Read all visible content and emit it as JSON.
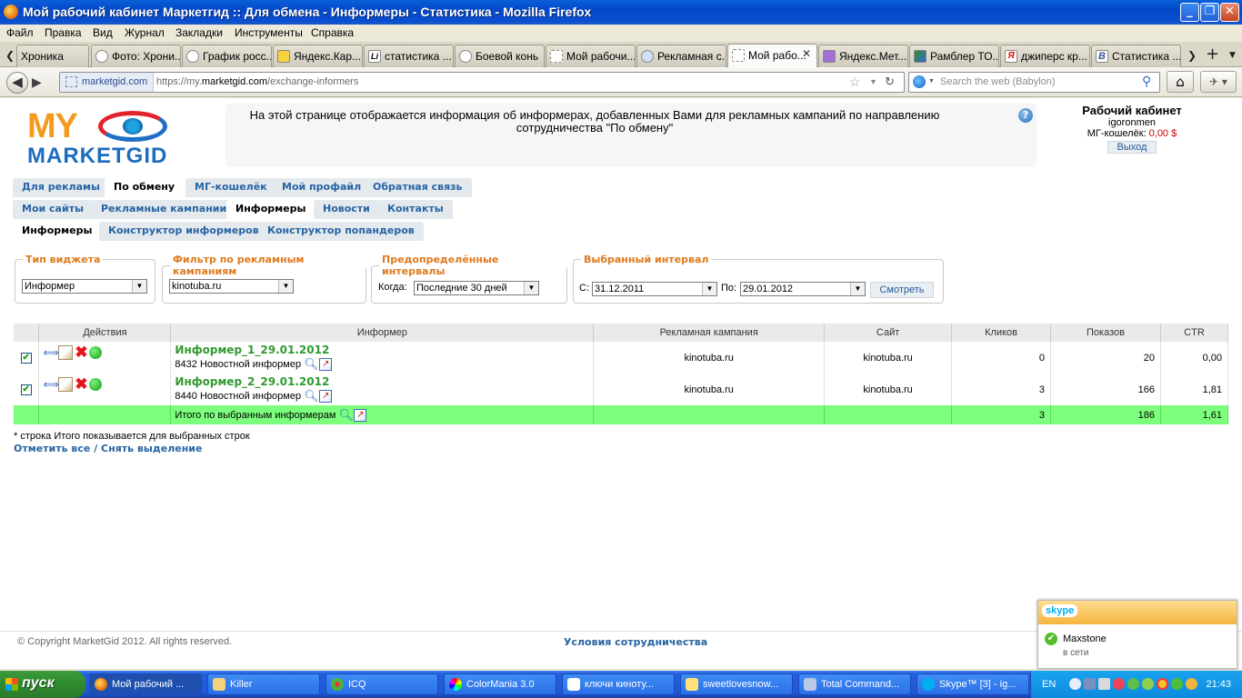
{
  "window": {
    "title": "Мой рабочий кабинет Маркетгид :: Для обмена - Информеры - Статистика - Mozilla Firefox",
    "min": "_",
    "max": "❐",
    "close": "✕"
  },
  "menu": [
    "Файл",
    "Правка",
    "Вид",
    "Журнал",
    "Закладки",
    "Инструменты",
    "Справка"
  ],
  "tabs": [
    "Хроника",
    "Фото: Хрони...",
    "График росс...",
    "Яндекс.Кар...",
    "статистика ...",
    "Боевой конь",
    "Мой рабочи...",
    "Рекламная с...",
    "Мой рабо...",
    "Яндекс.Мет...",
    "Рамблер ТО...",
    "джиперс кр...",
    "Статистика ..."
  ],
  "tab_icon_letters": {
    "statistika": "Li",
    "last": "B",
    "yandex": "Я"
  },
  "address": {
    "site": "marketgid.com",
    "url_prefix": "https://my.",
    "url_domain": "marketgid.com",
    "url_path": "/exchange-informers"
  },
  "search": {
    "placeholder": "Search the web (Babylon)"
  },
  "logo": {
    "my": "MY",
    "brand": "MARKETGID"
  },
  "info": "На этой странице отображается информация об информерах, добавленных Вами для рекламных кампаний по направлению сотрудничества \"По обмену\"",
  "help": "?",
  "account": {
    "title": "Рабочий кабинет",
    "user": "igoronmen",
    "wallet_label": "МГ-кошелёк:",
    "wallet_value": "0,00 $",
    "logout": "Выход"
  },
  "nav1": [
    "Для рекламы",
    "По обмену",
    "МГ-кошелёк",
    "Мой профайл",
    "Обратная связь"
  ],
  "nav2": [
    "Мои сайты",
    "Рекламные кампании",
    "Информеры",
    "Новости",
    "Контакты"
  ],
  "nav3": [
    "Информеры",
    "Конструктор информеров",
    "Конструктор попандеров"
  ],
  "filters": {
    "widget_type": {
      "legend": "Тип виджета",
      "value": "Информер"
    },
    "campaign": {
      "legend": "Фильтр по рекламным кампаниям",
      "value": "kinotuba.ru"
    },
    "preset": {
      "legend": "Предопределённые интервалы",
      "label": "Когда:",
      "value": "Последние 30 дней"
    },
    "interval": {
      "legend": "Выбранный интервал",
      "from_label": "С:",
      "from": "31.12.2011",
      "to_label": "По:",
      "to": "29.01.2012",
      "show": "Смотреть"
    }
  },
  "table": {
    "headers": [
      "",
      "Действия",
      "Информер",
      "Рекламная кампания",
      "Сайт",
      "Кликов",
      "Показов",
      "CTR"
    ],
    "rows": [
      {
        "name": "Информер_1_29.01.2012",
        "desc": "8432 Новостной информер",
        "campaign": "kinotuba.ru",
        "site": "kinotuba.ru",
        "clicks": "0",
        "shows": "20",
        "ctr": "0,00"
      },
      {
        "name": "Информер_2_29.01.2012",
        "desc": "8440 Новостной информер",
        "campaign": "kinotuba.ru",
        "site": "kinotuba.ru",
        "clicks": "3",
        "shows": "166",
        "ctr": "1,81"
      }
    ],
    "total": {
      "label": "Итого по выбранным информерам",
      "clicks": "3",
      "shows": "186",
      "ctr": "1,61"
    }
  },
  "note": "* строка Итого показывается для выбранных строк",
  "select_all": "Отметить все / Снять выделение",
  "footer": {
    "copyright": "© Copyright MarketGid 2012. All rights reserved.",
    "terms": "Условия сотрудничества"
  },
  "skype": {
    "logo": "skype",
    "contact": "Maxstone",
    "status": "в сети"
  },
  "taskbar": {
    "start": "пуск",
    "items": [
      "Мой рабочий ...",
      "Killer",
      "ICQ",
      "ColorMania 3.0",
      "ключи киноту...",
      "sweetlovesnow...",
      "Total Command...",
      "Skype™ [3] - ig..."
    ],
    "lang": "EN",
    "clock": "21:43"
  }
}
